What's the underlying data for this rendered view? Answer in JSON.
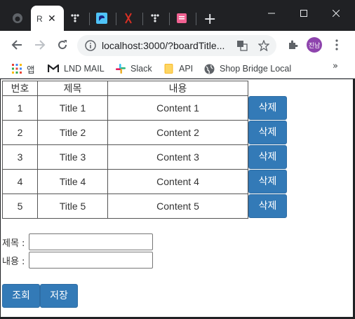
{
  "browser": {
    "active_tab_title": "R",
    "new_tab_label": "+",
    "url": "localhost:3000/?boardTitle...",
    "profile_initials": "진남",
    "colors": {
      "frame": "#202124",
      "avatar": "#8e44ad"
    },
    "tabs": [
      {
        "icon": "github-icon"
      },
      {
        "icon": "tree-icon"
      },
      {
        "icon": "app-icon"
      },
      {
        "icon": "pdf-icon"
      },
      {
        "icon": "tree-icon"
      },
      {
        "icon": "document-icon"
      }
    ],
    "bookmarks": [
      {
        "icon": "apps-grid-icon",
        "label": "앱"
      },
      {
        "icon": "gmail-icon",
        "label": "LND MAIL"
      },
      {
        "icon": "slack-icon",
        "label": "Slack"
      },
      {
        "icon": "folder-icon",
        "label": "API"
      },
      {
        "icon": "globe-icon",
        "label": "Shop Bridge Local"
      }
    ],
    "bookmarks_more": "»"
  },
  "board": {
    "headers": {
      "no": "번호",
      "title": "제목",
      "content": "내용"
    },
    "delete_label": "삭제",
    "rows": [
      {
        "no": "1",
        "title": "Title 1",
        "content": "Content 1"
      },
      {
        "no": "2",
        "title": "Title 2",
        "content": "Content 2"
      },
      {
        "no": "3",
        "title": "Title 3",
        "content": "Content 3"
      },
      {
        "no": "4",
        "title": "Title 4",
        "content": "Content 4"
      },
      {
        "no": "5",
        "title": "Title 5",
        "content": "Content 5"
      }
    ]
  },
  "form": {
    "title_label": "제목 :",
    "content_label": "내용 :",
    "title_value": "",
    "content_value": ""
  },
  "actions": {
    "search_label": "조회",
    "save_label": "저장"
  },
  "colors": {
    "primary_button": "#337ab7"
  }
}
